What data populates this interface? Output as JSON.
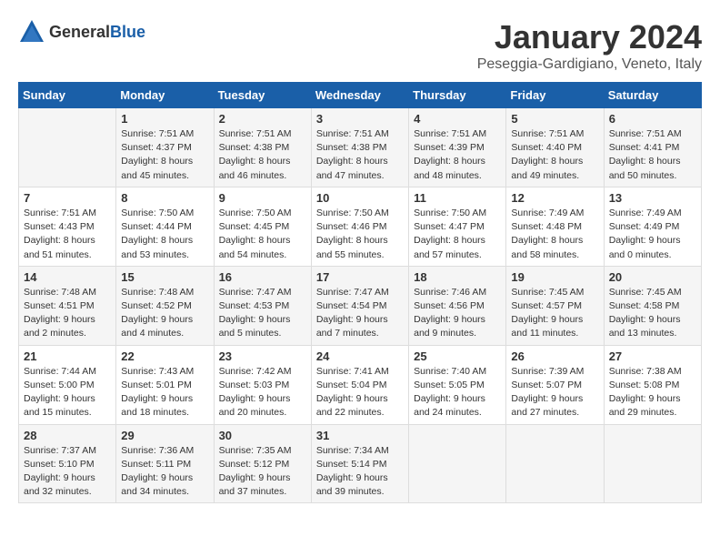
{
  "logo": {
    "text_general": "General",
    "text_blue": "Blue"
  },
  "title": {
    "month": "January 2024",
    "location": "Peseggia-Gardigiano, Veneto, Italy"
  },
  "days_of_week": [
    "Sunday",
    "Monday",
    "Tuesday",
    "Wednesday",
    "Thursday",
    "Friday",
    "Saturday"
  ],
  "weeks": [
    [
      {
        "day": "",
        "info": ""
      },
      {
        "day": "1",
        "info": "Sunrise: 7:51 AM\nSunset: 4:37 PM\nDaylight: 8 hours\nand 45 minutes."
      },
      {
        "day": "2",
        "info": "Sunrise: 7:51 AM\nSunset: 4:38 PM\nDaylight: 8 hours\nand 46 minutes."
      },
      {
        "day": "3",
        "info": "Sunrise: 7:51 AM\nSunset: 4:38 PM\nDaylight: 8 hours\nand 47 minutes."
      },
      {
        "day": "4",
        "info": "Sunrise: 7:51 AM\nSunset: 4:39 PM\nDaylight: 8 hours\nand 48 minutes."
      },
      {
        "day": "5",
        "info": "Sunrise: 7:51 AM\nSunset: 4:40 PM\nDaylight: 8 hours\nand 49 minutes."
      },
      {
        "day": "6",
        "info": "Sunrise: 7:51 AM\nSunset: 4:41 PM\nDaylight: 8 hours\nand 50 minutes."
      }
    ],
    [
      {
        "day": "7",
        "info": "Sunrise: 7:51 AM\nSunset: 4:43 PM\nDaylight: 8 hours\nand 51 minutes."
      },
      {
        "day": "8",
        "info": "Sunrise: 7:50 AM\nSunset: 4:44 PM\nDaylight: 8 hours\nand 53 minutes."
      },
      {
        "day": "9",
        "info": "Sunrise: 7:50 AM\nSunset: 4:45 PM\nDaylight: 8 hours\nand 54 minutes."
      },
      {
        "day": "10",
        "info": "Sunrise: 7:50 AM\nSunset: 4:46 PM\nDaylight: 8 hours\nand 55 minutes."
      },
      {
        "day": "11",
        "info": "Sunrise: 7:50 AM\nSunset: 4:47 PM\nDaylight: 8 hours\nand 57 minutes."
      },
      {
        "day": "12",
        "info": "Sunrise: 7:49 AM\nSunset: 4:48 PM\nDaylight: 8 hours\nand 58 minutes."
      },
      {
        "day": "13",
        "info": "Sunrise: 7:49 AM\nSunset: 4:49 PM\nDaylight: 9 hours\nand 0 minutes."
      }
    ],
    [
      {
        "day": "14",
        "info": "Sunrise: 7:48 AM\nSunset: 4:51 PM\nDaylight: 9 hours\nand 2 minutes."
      },
      {
        "day": "15",
        "info": "Sunrise: 7:48 AM\nSunset: 4:52 PM\nDaylight: 9 hours\nand 4 minutes."
      },
      {
        "day": "16",
        "info": "Sunrise: 7:47 AM\nSunset: 4:53 PM\nDaylight: 9 hours\nand 5 minutes."
      },
      {
        "day": "17",
        "info": "Sunrise: 7:47 AM\nSunset: 4:54 PM\nDaylight: 9 hours\nand 7 minutes."
      },
      {
        "day": "18",
        "info": "Sunrise: 7:46 AM\nSunset: 4:56 PM\nDaylight: 9 hours\nand 9 minutes."
      },
      {
        "day": "19",
        "info": "Sunrise: 7:45 AM\nSunset: 4:57 PM\nDaylight: 9 hours\nand 11 minutes."
      },
      {
        "day": "20",
        "info": "Sunrise: 7:45 AM\nSunset: 4:58 PM\nDaylight: 9 hours\nand 13 minutes."
      }
    ],
    [
      {
        "day": "21",
        "info": "Sunrise: 7:44 AM\nSunset: 5:00 PM\nDaylight: 9 hours\nand 15 minutes."
      },
      {
        "day": "22",
        "info": "Sunrise: 7:43 AM\nSunset: 5:01 PM\nDaylight: 9 hours\nand 18 minutes."
      },
      {
        "day": "23",
        "info": "Sunrise: 7:42 AM\nSunset: 5:03 PM\nDaylight: 9 hours\nand 20 minutes."
      },
      {
        "day": "24",
        "info": "Sunrise: 7:41 AM\nSunset: 5:04 PM\nDaylight: 9 hours\nand 22 minutes."
      },
      {
        "day": "25",
        "info": "Sunrise: 7:40 AM\nSunset: 5:05 PM\nDaylight: 9 hours\nand 24 minutes."
      },
      {
        "day": "26",
        "info": "Sunrise: 7:39 AM\nSunset: 5:07 PM\nDaylight: 9 hours\nand 27 minutes."
      },
      {
        "day": "27",
        "info": "Sunrise: 7:38 AM\nSunset: 5:08 PM\nDaylight: 9 hours\nand 29 minutes."
      }
    ],
    [
      {
        "day": "28",
        "info": "Sunrise: 7:37 AM\nSunset: 5:10 PM\nDaylight: 9 hours\nand 32 minutes."
      },
      {
        "day": "29",
        "info": "Sunrise: 7:36 AM\nSunset: 5:11 PM\nDaylight: 9 hours\nand 34 minutes."
      },
      {
        "day": "30",
        "info": "Sunrise: 7:35 AM\nSunset: 5:12 PM\nDaylight: 9 hours\nand 37 minutes."
      },
      {
        "day": "31",
        "info": "Sunrise: 7:34 AM\nSunset: 5:14 PM\nDaylight: 9 hours\nand 39 minutes."
      },
      {
        "day": "",
        "info": ""
      },
      {
        "day": "",
        "info": ""
      },
      {
        "day": "",
        "info": ""
      }
    ]
  ]
}
